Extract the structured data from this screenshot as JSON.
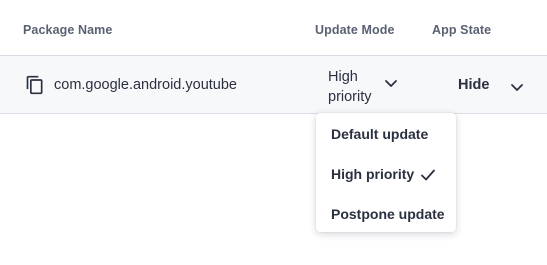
{
  "header": {
    "package_name": "Package Name",
    "update_mode": "Update Mode",
    "app_state": "App State"
  },
  "row": {
    "package": "com.google.android.youtube",
    "update_mode_line1": "High",
    "update_mode_line2": "priority",
    "app_state": "Hide"
  },
  "menu": {
    "items": [
      {
        "label": "Default update"
      },
      {
        "label": "High priority",
        "selected": true
      },
      {
        "label": "Postpone update"
      }
    ]
  },
  "icons": [
    "copy-icon",
    "chevron-down-icon",
    "check-icon"
  ]
}
